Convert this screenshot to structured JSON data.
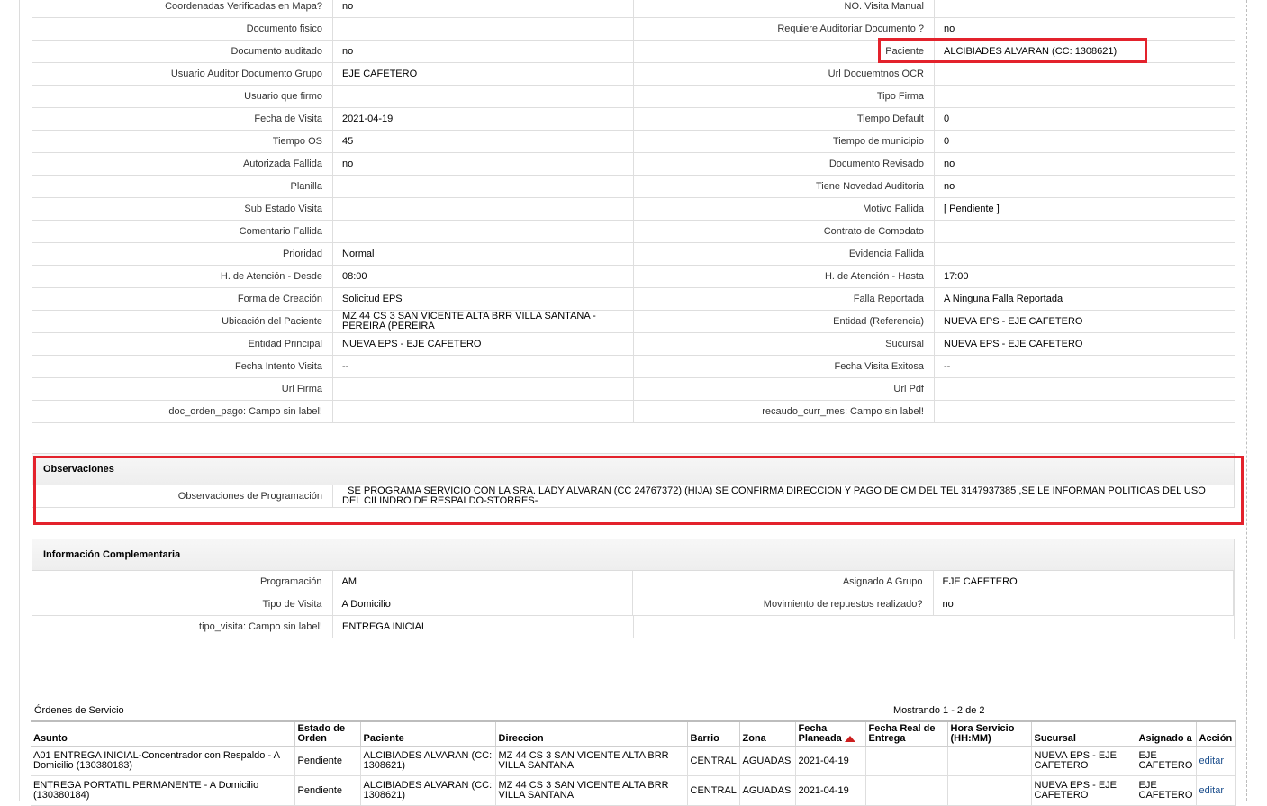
{
  "details": [
    [
      "Coordenadas Verificadas en Mapa?",
      "no",
      "NO. Visita Manual",
      ""
    ],
    [
      "Documento fisico",
      "",
      "Requiere Auditoriar Documento ?",
      "no"
    ],
    [
      "Documento auditado",
      "no",
      "Paciente",
      "ALCIBIADES ALVARAN (CC: 1308621)"
    ],
    [
      "Usuario Auditor Documento Grupo",
      "EJE CAFETERO",
      "Url Docuemtnos OCR",
      ""
    ],
    [
      "Usuario que firmo",
      "",
      "Tipo Firma",
      ""
    ],
    [
      "Fecha de Visita",
      " 2021-04-19",
      "Tiempo Default",
      "0"
    ],
    [
      "Tiempo OS",
      "45",
      "Tiempo de municipio",
      "0"
    ],
    [
      "Autorizada Fallida",
      "no",
      "Documento Revisado",
      " no"
    ],
    [
      "Planilla",
      "",
      "Tiene Novedad Auditoria",
      " no"
    ],
    [
      "Sub Estado Visita",
      "",
      "Motivo Fallida",
      "[ Pendiente ]"
    ],
    [
      "Comentario Fallida",
      "",
      "Contrato de Comodato",
      ""
    ],
    [
      "Prioridad",
      "Normal",
      "Evidencia Fallida",
      ""
    ],
    [
      "H. de Atención - Desde",
      "08:00",
      "H. de Atención - Hasta",
      "17:00"
    ],
    [
      "Forma de Creación",
      "Solicitud EPS",
      "Falla Reportada",
      "A Ninguna Falla Reportada"
    ],
    [
      "Ubicación del Paciente",
      "MZ 44 CS 3 SAN VICENTE ALTA BRR VILLA SANTANA - PEREIRA (PEREIRA",
      "Entidad (Referencia)",
      "NUEVA EPS - EJE CAFETERO"
    ],
    [
      "Entidad Principal",
      "NUEVA EPS - EJE CAFETERO",
      "Sucursal",
      "NUEVA EPS - EJE CAFETERO"
    ],
    [
      "Fecha Intento Visita",
      " --",
      "Fecha Visita Exitosa",
      " --"
    ],
    [
      "Url Firma",
      "",
      "Url Pdf",
      ""
    ],
    [
      "doc_orden_pago: Campo sin label!",
      "",
      "recaudo_curr_mes: Campo sin label!",
      ""
    ]
  ],
  "observaciones": {
    "title": "Observaciones",
    "label": "Observaciones de Programación",
    "value": "  SE PROGRAMA SERVICIO CON LA SRA. LADY ALVARAN (CC 24767372) (HIJA) SE CONFIRMA DIRECCION Y PAGO DE CM DEL TEL 3147937385 ,SE LE INFORMAN POLITICAS DEL USO DEL CILINDRO DE RESPALDO-STORRES-"
  },
  "complementaria": {
    "title": "Información Complementaria",
    "rows": [
      [
        "Programación",
        "AM",
        "Asignado A Grupo",
        "EJE CAFETERO"
      ],
      [
        "Tipo de Visita",
        "A Domicilio",
        "Movimiento de repuestos realizado?",
        " no"
      ],
      [
        "tipo_visita: Campo sin label!",
        "ENTREGA INICIAL",
        "",
        ""
      ]
    ]
  },
  "orders": {
    "title": "Órdenes de Servicio",
    "count_text": "Mostrando 1 - 2 de 2",
    "headers": [
      "Asunto",
      "Estado de Orden",
      "Paciente",
      "Direccion",
      "Barrio",
      "Zona",
      "Fecha Planeada",
      "Fecha Real de Entrega",
      "Hora Servicio (HH:MM)",
      "Sucursal",
      "Asignado a",
      "Acción"
    ],
    "rows": [
      [
        "A01 ENTREGA INICIAL-Concentrador con Respaldo - A Domicilio (130380183)",
        "Pendiente",
        "ALCIBIADES ALVARAN (CC: 1308621)",
        "MZ 44 CS 3 SAN VICENTE ALTA BRR VILLA SANTANA",
        "CENTRAL",
        "AGUADAS",
        "2021-04-19",
        "",
        "",
        "NUEVA EPS - EJE CAFETERO",
        "EJE CAFETERO",
        "editar"
      ],
      [
        "ENTREGA PORTATIL PERMANENTE - A Domicilio (130380184)",
        "Pendiente",
        "ALCIBIADES ALVARAN (CC: 1308621)",
        "MZ 44 CS 3 SAN VICENTE ALTA BRR VILLA SANTANA",
        "CENTRAL",
        "AGUADAS",
        "2021-04-19",
        "",
        "",
        "NUEVA EPS - EJE CAFETERO",
        "EJE CAFETERO",
        "editar"
      ]
    ]
  },
  "colors": {
    "highlight": "#e3222c",
    "sort_arrow": "#cc1e1e",
    "link": "#1a4d8c"
  },
  "icons": {
    "sort": "sort-ascending-triangle-icon"
  }
}
